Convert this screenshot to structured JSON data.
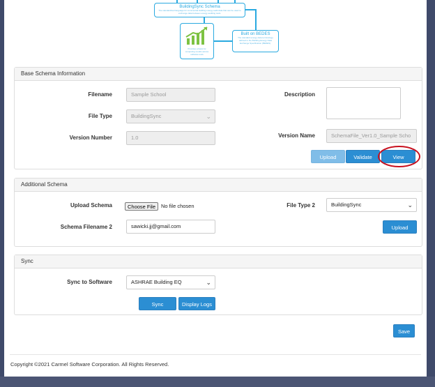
{
  "diagram": {
    "schema_box": {
      "title": "BuildingSync Schema",
      "desc": "The standardized language for commercial building energy audit data that can be used to exchange data between energy auditing tools."
    },
    "bedes_box": {
      "title": "Built on BEDES",
      "desc": "The standard energy data terminology defined in the Building Energy Data Exchange Specification (BEDES)."
    },
    "chart_box": {
      "desc": "Provides a basis for comparing results across software tools"
    }
  },
  "base_schema": {
    "header": "Base Schema Information",
    "filename_label": "Filename",
    "filename_value": "Sample School",
    "file_type_label": "File Type",
    "file_type_value": "BuildingSync",
    "version_number_label": "Version Number",
    "version_number_value": "1.0",
    "description_label": "Description",
    "version_name_label": "Version Name",
    "version_name_value": "SchemaFile_Ver1.0_Sample Scho",
    "upload_label": "Upload",
    "validate_label": "Validate",
    "view_label": "View"
  },
  "additional_schema": {
    "header": "Additional Schema",
    "upload_schema_label": "Upload Schema",
    "choose_file_label": "Choose File",
    "no_file_text": "No file chosen",
    "schema_filename2_label": "Schema Filename 2",
    "schema_filename2_value": "sawicki.jj@gmail.com",
    "file_type2_label": "File Type 2",
    "file_type2_value": "BuildingSync",
    "upload_label": "Upload"
  },
  "sync": {
    "header": "Sync",
    "sync_to_label": "Sync to Software",
    "sync_to_value": "ASHRAE Building EQ",
    "sync_label": "Sync",
    "display_logs_label": "Display Logs"
  },
  "save_label": "Save",
  "footer": "Copyright ©2021 Carmel Software Corporation. All Rights Reserved.",
  "colors": {
    "accent": "#2b8ed3",
    "accent_light": "#80bde8",
    "highlight_ring": "#c8101e",
    "diagram": "#29a9e0",
    "chart_icon": "#7dc242"
  },
  "icons": {
    "chevron": "chevron-down-icon",
    "chart": "bar-chart-icon"
  }
}
